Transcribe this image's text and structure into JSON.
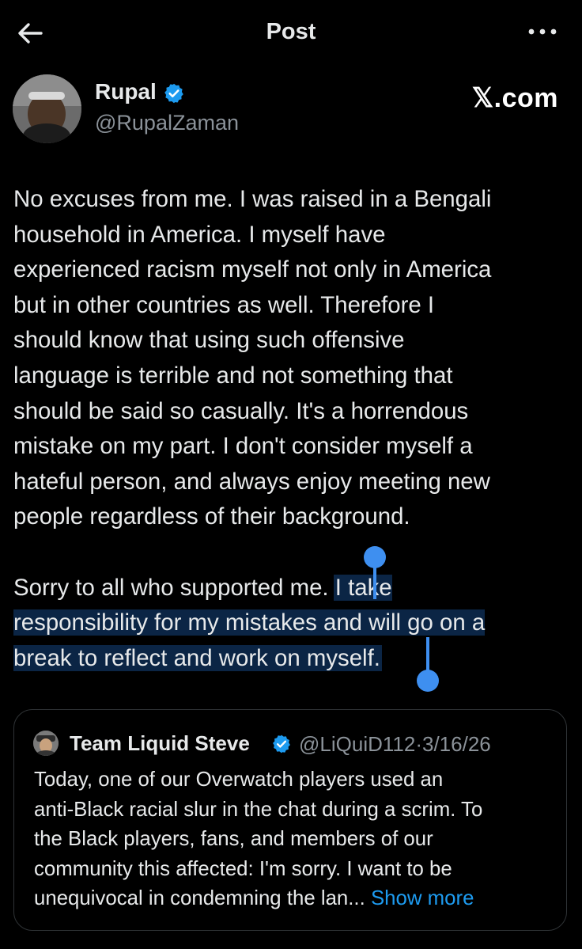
{
  "header": {
    "title": "Post",
    "back_icon": "arrow-left-icon",
    "more_icon": "more-horizontal-icon"
  },
  "author": {
    "name": "Rupal",
    "handle": "@RupalZaman",
    "verified_color": "#1d9bf0"
  },
  "watermark": "𝕏.com",
  "post": {
    "paragraph1": "No excuses from me. I was raised in a Bengali\nhousehold in America. I myself have\nexperienced racism myself not only in America\nbut in other countries as well. Therefore I\nshould know that using such offensive\nlanguage is terrible and not something that\nshould be said so casually. It's a horrendous\nmistake on my part. I don't consider myself a\nhateful person, and always enjoy meeting new\npeople regardless of their background.",
    "paragraph2_before": "Sorry to all who supported me. ",
    "paragraph2_selected": "I take\nresponsibility for my mistakes and will go on a\nbreak to reflect and work on myself."
  },
  "selection": {
    "highlight_color": "#0b2545",
    "handle_color": "#3e8ff0"
  },
  "quote": {
    "name": "Team Liquid Steve",
    "handle": "@LiQuiD112",
    "separator": "·",
    "date": "3/16/26",
    "text": "Today, one of our Overwatch players used an\nanti-Black racial slur in the chat during a scrim. To\nthe Black players, fans, and members of our\ncommunity this affected: I'm sorry. I want to be\nunequivocal in condemning the lan... ",
    "show_more": "Show more"
  },
  "colors": {
    "background": "#000000",
    "text": "#e7e9ea",
    "muted": "#8b9299",
    "link": "#1d9bf0",
    "border": "#2f3336"
  }
}
